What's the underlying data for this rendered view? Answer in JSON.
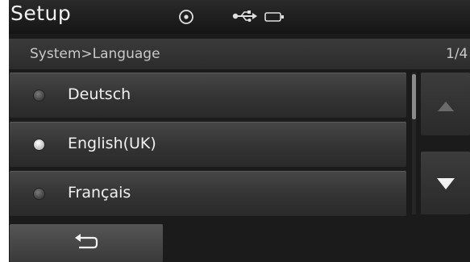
{
  "header": {
    "title": "Setup",
    "status_icons": [
      "disc-icon",
      "usb-icon",
      "battery-icon"
    ]
  },
  "breadcrumb": "System>Language",
  "page_indicator": "1/4",
  "languages": [
    {
      "label": "Deutsch",
      "selected": false
    },
    {
      "label": "English(UK)",
      "selected": true
    },
    {
      "label": "Français",
      "selected": false
    }
  ],
  "scroll": {
    "up_icon": "triangle-up-icon",
    "down_icon": "triangle-down-icon"
  },
  "footer": {
    "back_icon": "return-arrow-icon"
  },
  "colors": {
    "background": "#1b1b1b",
    "text": "#f0f0f0",
    "selected_radio": "#ffffff"
  }
}
